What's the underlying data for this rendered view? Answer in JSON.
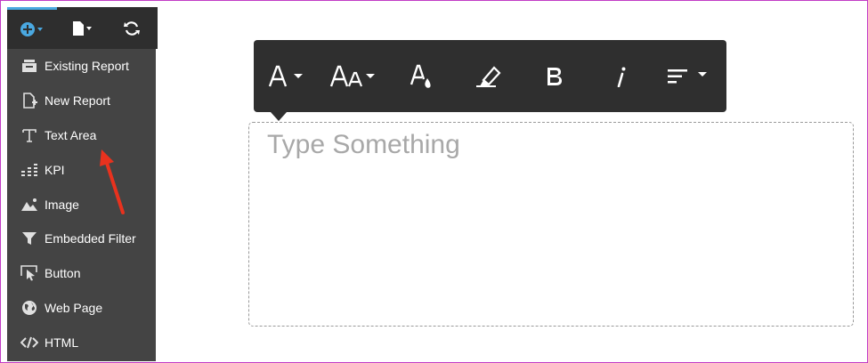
{
  "menu": {
    "items": [
      {
        "label": "Existing Report",
        "icon": "existing-report-icon"
      },
      {
        "label": "New Report",
        "icon": "new-report-icon"
      },
      {
        "label": "Text Area",
        "icon": "text-area-icon"
      },
      {
        "label": "KPI",
        "icon": "kpi-icon"
      },
      {
        "label": "Image",
        "icon": "image-icon"
      },
      {
        "label": "Embedded Filter",
        "icon": "filter-icon"
      },
      {
        "label": "Button",
        "icon": "button-icon"
      },
      {
        "label": "Web Page",
        "icon": "globe-icon"
      },
      {
        "label": "HTML",
        "icon": "code-icon"
      }
    ]
  },
  "topbar": {
    "buttons": [
      "add-icon",
      "page-icon",
      "refresh-icon"
    ],
    "accent": "#4aa8e0"
  },
  "editor": {
    "placeholder": "Type Something",
    "toolbar": [
      "font-icon",
      "font-size-icon",
      "font-color-icon",
      "highlight-icon",
      "bold-icon",
      "italic-icon",
      "align-icon"
    ]
  },
  "colors": {
    "annotation_arrow": "#e8321e",
    "frame": "#c23cc6"
  }
}
